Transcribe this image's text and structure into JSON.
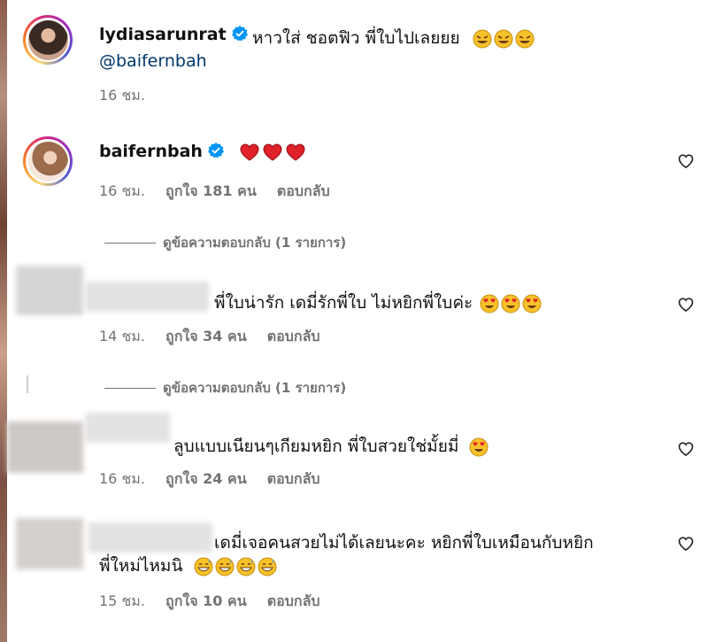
{
  "comments": [
    {
      "username": "lydiasarunrat",
      "text": "หาวใส่ ชอตฟิว พี่ใบไปเลยยย",
      "mention": "@baifernbah",
      "time": "16 ชม."
    },
    {
      "username": "baifernbah",
      "time": "16 ชม.",
      "likes": "ถูกใจ 181 คน",
      "reply": "ตอบกลับ",
      "view_replies": "ดูข้อความตอบกลับ (1 รายการ)"
    },
    {
      "text": "พี่ใบน่ารัก เดมี่รักพี่ใบ ไม่หยิกพี่ใบค่ะ",
      "time": "14 ชม.",
      "likes": "ถูกใจ 34 คน",
      "reply": "ตอบกลับ",
      "view_replies": "ดูข้อความตอบกลับ (1 รายการ)"
    },
    {
      "text": "ลูบแบบเนียนๆเกียมหยิก พี่ใบสวยใช่มั้ยมี่",
      "time": "16 ชม.",
      "likes": "ถูกใจ 24 คน",
      "reply": "ตอบกลับ"
    },
    {
      "text_line1": "เดมี่เจอคนสวยไม่ได้เลยนะคะ หยิกพี่ใบเหมือนกับหยิก",
      "text_line2": "พี่ใหม่ไหมนิ",
      "time": "15 ชม.",
      "likes": "ถูกใจ 10 คน",
      "reply": "ตอบกลับ"
    }
  ],
  "icons": {
    "verified": "verified-badge-icon",
    "like": "heart-outline-icon",
    "emoji_rofl": "rofl-emoji",
    "emoji_heart": "red-heart-emoji",
    "emoji_heart_eyes": "heart-eyes-emoji",
    "emoji_grin": "grinning-sweat-emoji"
  },
  "colors": {
    "verified": "#0095f6",
    "meta": "#737373",
    "mention": "#00376b"
  }
}
